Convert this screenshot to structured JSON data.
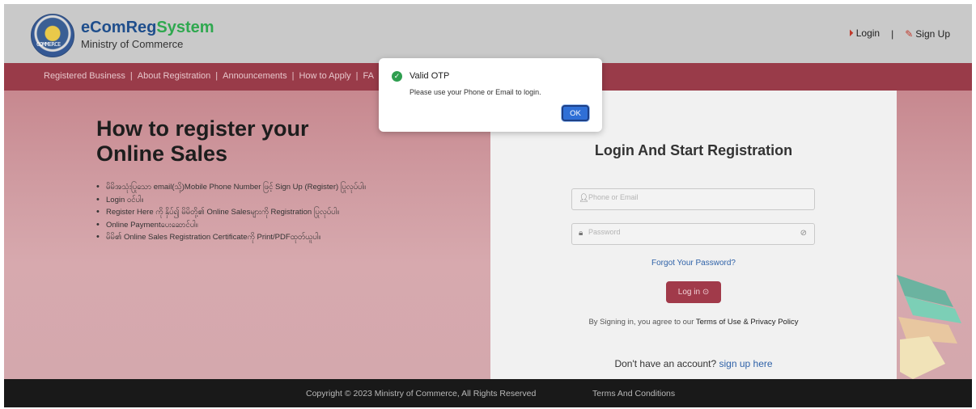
{
  "header": {
    "logo_text": "COMMERCE",
    "brand_prefix": "eComReg",
    "brand_suffix": "System",
    "subtitle": "Ministry of Commerce",
    "login_label": "Login",
    "separator": "|",
    "signup_label": "Sign Up"
  },
  "nav": {
    "items": [
      "Registered Business",
      "About Registration",
      "Announcements",
      "How to Apply",
      "FA"
    ]
  },
  "hero": {
    "heading": "How to register your Online Sales",
    "steps": [
      "မိမိအသုံးပြုသော email(သို့)Mobile Phone Number ဖြင့် Sign Up (Register) ပြုလုပ်ပါ။",
      "Login ဝင်ပါ။",
      "Register Here ကို နှိပ်၍ မိမိတို့၏ Online Salesများကို Registration ပြုလုပ်ပါ။",
      "Online Paymentပေးဆောင်ပါ။",
      "မိမိ၏ Online Sales Registration Certificateကို Print/PDFထုတ်ယူပါ။"
    ]
  },
  "login": {
    "title": "Login And Start Registration",
    "phone_placeholder": "Phone or Email",
    "password_placeholder": "Password",
    "forgot": "Forgot Your Password?",
    "button": "Log in",
    "terms_prefix": "By Signing in, you agree to our",
    "terms_link": "Terms of Use & Privacy Policy",
    "signup_prefix": "Don't have an account?",
    "signup_link": "sign up here"
  },
  "footer": {
    "copyright": "Copyright © 2023 Ministry of Commerce, All Rights Reserved",
    "terms": "Terms And Conditions"
  },
  "modal": {
    "title": "Valid OTP",
    "message": "Please use your Phone or Email to login.",
    "ok": "OK"
  }
}
